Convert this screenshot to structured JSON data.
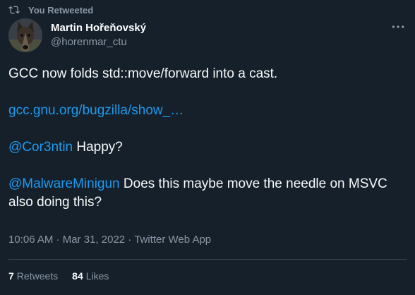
{
  "social_context": {
    "icon": "retweet-icon",
    "text": "You Retweeted"
  },
  "author": {
    "avatar_icon": "dog-avatar",
    "display_name": "Martin Hořeňovský",
    "handle": "@horenmar_ctu"
  },
  "menu": {
    "icon": "more-options-icon"
  },
  "tweet": {
    "line1": "GCC now folds std::move/forward into a cast.",
    "link": "gcc.gnu.org/bugzilla/show_…",
    "mention1": "@Cor3ntin",
    "text2": " Happy?",
    "mention2": "@MalwareMinigun",
    "text3": " Does this maybe move the needle on MSVC also doing this?"
  },
  "meta": {
    "time": "10:06 AM",
    "sep1": " · ",
    "date": "Mar 31, 2022",
    "sep2": " · ",
    "source": "Twitter Web App"
  },
  "stats": {
    "retweets_count": "7",
    "retweets_label": "Retweets",
    "likes_count": "84",
    "likes_label": "Likes"
  },
  "colors": {
    "background": "#15202b",
    "accent": "#1d9bf0",
    "text_primary": "#f7f9f9",
    "text_secondary": "#8b98a5",
    "divider": "#38444d"
  }
}
